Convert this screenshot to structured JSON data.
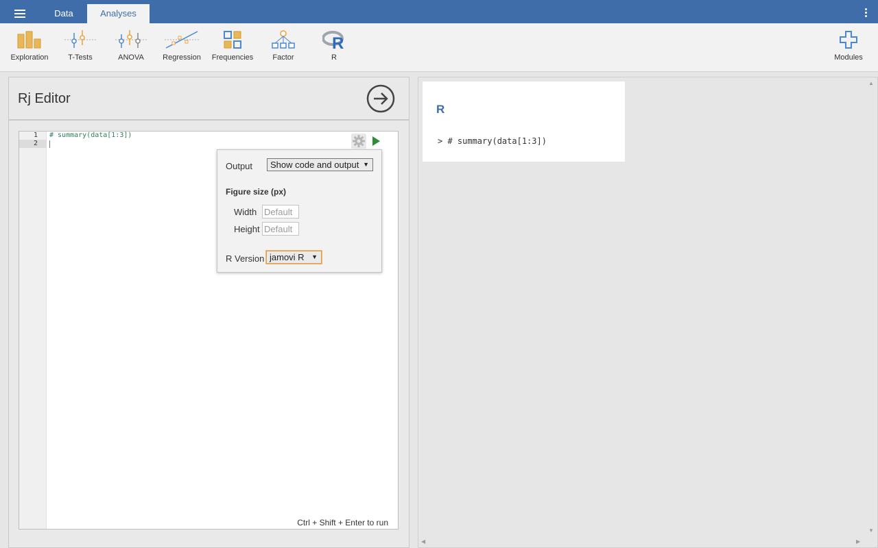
{
  "colors": {
    "topbar": "#3e6da9",
    "accent_orange": "#e8a33c",
    "accent_blue": "#4a87d1",
    "run_green": "#2e8b3a"
  },
  "topbar": {
    "tabs": [
      {
        "label": "Data"
      },
      {
        "label": "Analyses",
        "active": true
      }
    ]
  },
  "ribbon": {
    "items": [
      {
        "label": "Exploration",
        "icon": "exploration-icon"
      },
      {
        "label": "T-Tests",
        "icon": "ttests-icon"
      },
      {
        "label": "ANOVA",
        "icon": "anova-icon"
      },
      {
        "label": "Regression",
        "icon": "regression-icon"
      },
      {
        "label": "Frequencies",
        "icon": "frequencies-icon"
      },
      {
        "label": "Factor",
        "icon": "factor-icon"
      },
      {
        "label": "R",
        "icon": "r-icon"
      }
    ],
    "modules_label": "Modules"
  },
  "editor": {
    "title": "Rj Editor",
    "lines": [
      "# summary(data[1:3])",
      ""
    ],
    "line_numbers": [
      "1",
      "2"
    ],
    "hint": "Ctrl + Shift + Enter to run"
  },
  "options": {
    "output_label": "Output",
    "output_value": "Show code and output",
    "figure_size_title": "Figure size (px)",
    "width_label": "Width",
    "width_placeholder": "Default",
    "height_label": "Height",
    "height_placeholder": "Default",
    "rversion_label": "R Version",
    "rversion_value": "jamovi R"
  },
  "results": {
    "title": "R",
    "line": "> # summary(data[1:3])"
  }
}
